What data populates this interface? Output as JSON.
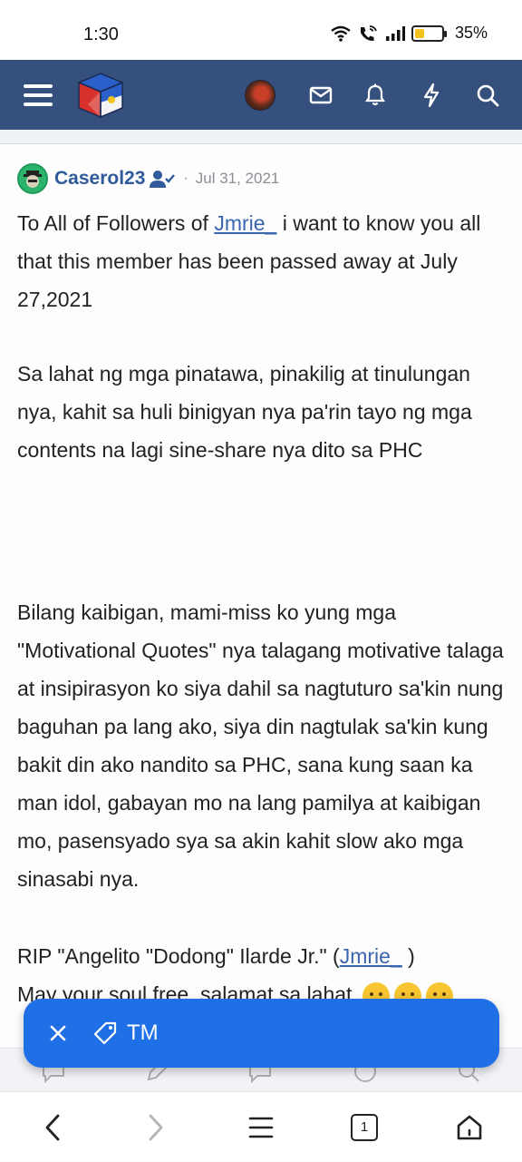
{
  "status_bar": {
    "time": "1:30",
    "battery": "35%",
    "battery_level": 0.35,
    "icons": [
      "wifi-icon",
      "wifi-call-icon",
      "signal-icon",
      "battery-icon"
    ]
  },
  "header": {
    "icons": [
      "menu-icon",
      "site-logo",
      "user-avatar",
      "mail-icon",
      "bell-icon",
      "bolt-icon",
      "search-icon"
    ],
    "accent": "#35507c"
  },
  "post": {
    "username": "Caserol23",
    "separator": "·",
    "date": "Jul 31, 2021",
    "p1_before": "To All of Followers of ",
    "p1_mention": "Jmrie_",
    "p1_after": " i want to know you all that this member has been passed away at July 27,2021",
    "p2": "Sa lahat ng mga pinatawa, pinakilig at tinulungan nya, kahit sa huli binigyan nya pa'rin tayo ng mga contents na lagi sine-share nya dito sa PHC",
    "p3": "Bilang kaibigan, mami-miss ko yung mga \"Motivational Quotes\" nya talagang motivative talaga at insipirasyon ko siya dahil sa nagtuturo sa'kin nung baguhan pa lang ako, siya din nagtulak sa'kin kung bakit din ako nandito sa PHC, sana kung saan ka man idol, gabayan mo na lang pamilya at kaibigan mo, pasensyado sya sa akin kahit slow ako mga sinasabi nya.",
    "p4_before": "RIP \"Angelito \"Dodong\" Ilarde Jr.\" (",
    "p4_mention": "Jmrie_",
    "p4_after": " )",
    "p5": "May your soul free, salamat sa lahat",
    "link_color": "#3a66b0"
  },
  "tag_chip": {
    "label": "TM",
    "color": "#1f6fe6"
  },
  "browser_nav": {
    "tab_count": "1",
    "icons": [
      "back-icon",
      "forward-icon",
      "menu-icon",
      "tabs-icon",
      "home-icon"
    ]
  }
}
